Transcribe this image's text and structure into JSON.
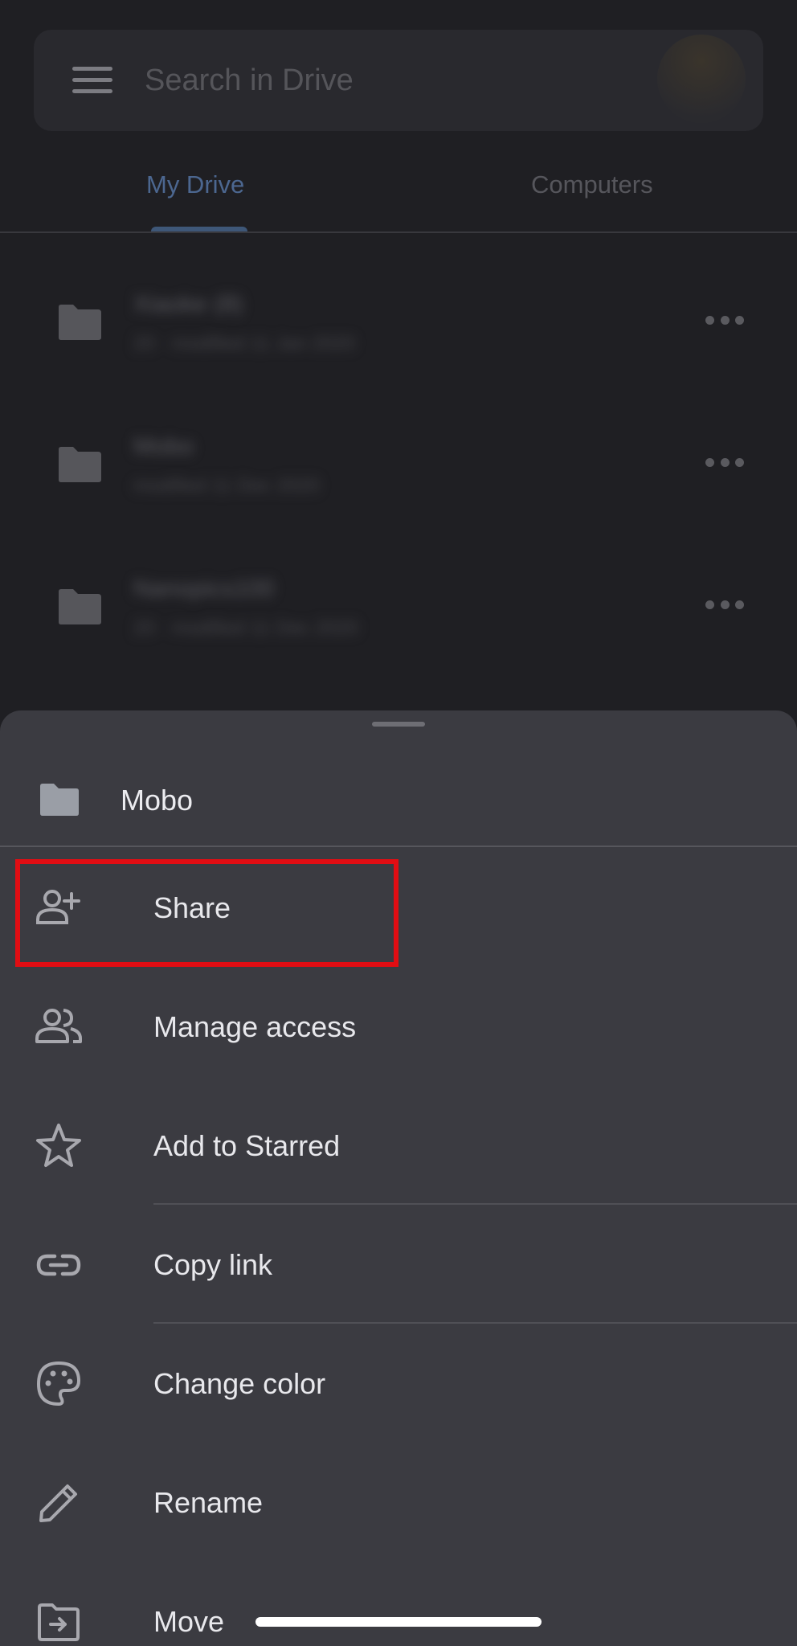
{
  "search": {
    "placeholder": "Search in Drive"
  },
  "tabs": [
    {
      "label": "My Drive",
      "active": true
    },
    {
      "label": "Computers",
      "active": false
    }
  ],
  "files": [
    {
      "name": "Xiaoke (8)",
      "meta": "20 · modified 11 Jan 2020"
    },
    {
      "name": "Mobo",
      "meta": "modified 11 Dec 2020"
    },
    {
      "name": "Nanopics100",
      "meta": "20 · modified 11 Dec 2020"
    }
  ],
  "sheet": {
    "title": "Mobo",
    "items": [
      {
        "label": "Share",
        "icon": "person-add-icon"
      },
      {
        "label": "Manage access",
        "icon": "people-icon"
      },
      {
        "label": "Add to Starred",
        "icon": "star-outline-icon"
      },
      {
        "label": "Copy link",
        "icon": "link-icon"
      },
      {
        "label": "Change color",
        "icon": "palette-icon"
      },
      {
        "label": "Rename",
        "icon": "pencil-icon"
      },
      {
        "label": "Move",
        "icon": "move-folder-icon"
      }
    ]
  },
  "colors": {
    "highlight": "#e10d13",
    "sheet_bg": "#3b3b41",
    "background": "#1f1f23",
    "active_tab": "#4c6790"
  }
}
